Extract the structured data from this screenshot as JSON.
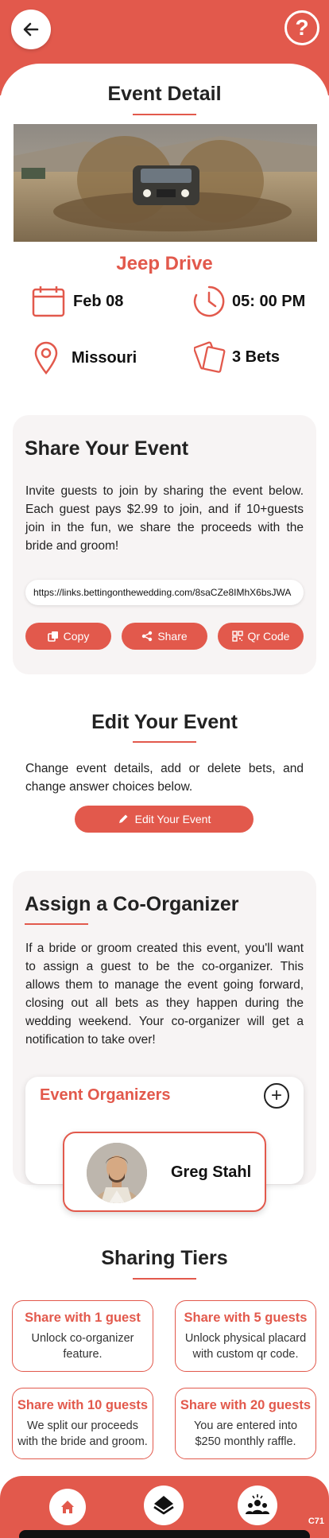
{
  "header": {
    "back_icon": "arrow-left-icon",
    "help_icon": "question-icon",
    "help_glyph": "?"
  },
  "event_detail": {
    "title": "Event Detail",
    "event_name": "Jeep Drive",
    "date": "Feb 08",
    "time": "05: 00 PM",
    "location": "Missouri",
    "bets": "3 Bets"
  },
  "share": {
    "title": "Share Your Event",
    "description": "Invite guests to join by sharing the event below. Each guest pays $2.99 to join, and if 10+guests join in the fun, we share the proceeds with the bride and groom!",
    "link": "https://links.bettingonthewedding.com/8saCZe8IMhX6bsJWA",
    "copy_label": "Copy",
    "share_label": "Share",
    "qr_label": "Qr Code"
  },
  "edit": {
    "title": "Edit Your Event",
    "description": "Change event details, add or delete bets, and change answer choices below.",
    "button_label": "Edit Your Event"
  },
  "co_organizer": {
    "title": "Assign a Co-Organizer",
    "description": "If a bride or groom created this event, you'll want to assign a guest to be the co-organizer. This allows them to manage the event going forward, closing out all bets as they happen during the wedding weekend. Your co-organizer will get a notification to take over!",
    "organizers_title": "Event Organizers",
    "add_glyph": "+",
    "organizer_name": "Greg Stahl"
  },
  "tiers": {
    "title": "Sharing Tiers",
    "items": [
      {
        "title": "Share with 1 guest",
        "desc": "Unlock co-organizer feature."
      },
      {
        "title": "Share with 5 guests",
        "desc": "Unlock physical placard with custom qr code."
      },
      {
        "title": "Share with 10 guests",
        "desc": "We split our proceeds with the bride and groom."
      },
      {
        "title": "Share with 20 guests",
        "desc": "You are entered into $250 monthly raffle."
      }
    ]
  },
  "bottom_nav": {
    "items": [
      "home-icon",
      "layers-icon",
      "group-icon"
    ]
  },
  "footer": {
    "version": "C71"
  },
  "colors": {
    "accent": "#e2594c",
    "card_bg": "#f7f4f4"
  }
}
